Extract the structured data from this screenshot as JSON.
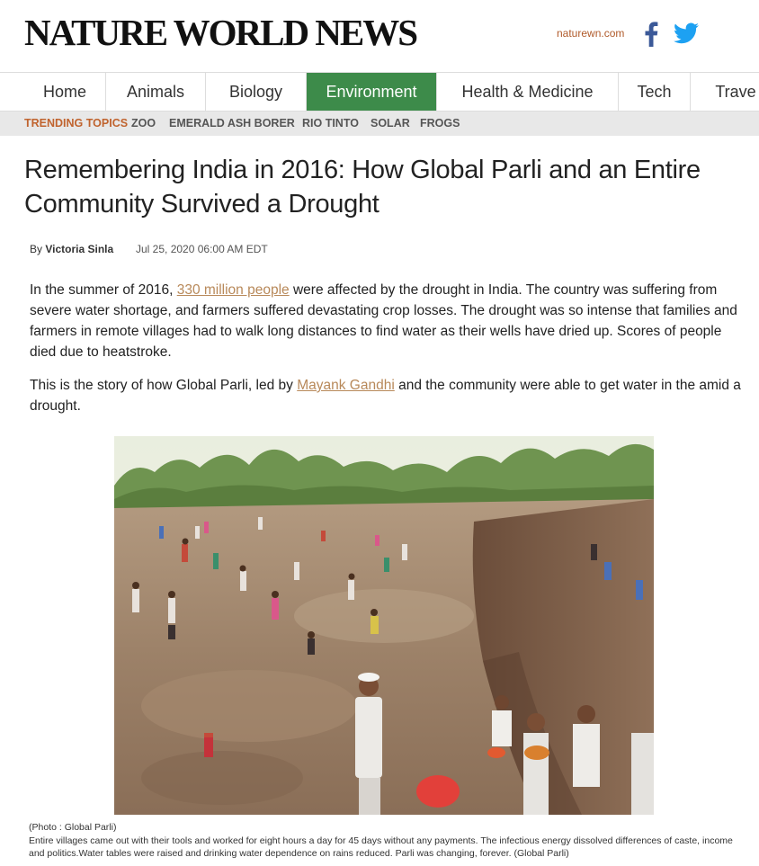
{
  "header": {
    "logo": "NATURE WORLD NEWS",
    "site_link": "naturewn.com"
  },
  "nav": {
    "items": [
      {
        "label": "Home"
      },
      {
        "label": "Animals"
      },
      {
        "label": "Biology"
      },
      {
        "label": "Environment"
      },
      {
        "label": "Health & Medicine"
      },
      {
        "label": "Tech"
      },
      {
        "label": "Trave"
      }
    ],
    "active": "Environment"
  },
  "trending": {
    "label": "TRENDING TOPICS",
    "topics": [
      "ZOO",
      "EMERALD ASH BORER",
      "RIO TINTO",
      "SOLAR",
      "FROGS"
    ]
  },
  "article": {
    "headline": "Remembering India in 2016: How Global Parli and an Entire Community Survived a Drought",
    "byline_prefix": "By ",
    "author": "Victoria Sinla",
    "date": "Jul 25, 2020 06:00 AM EDT",
    "p1_before": "In the summer of 2016, ",
    "p1_link": "330 million people",
    "p1_after": " were affected by the drought in India. The country was suffering from severe water shortage, and farmers suffered devastating crop losses. The drought was so intense that families and farmers in remote villages had to walk long distances to find water as their wells have dried up. Scores of people died due to heatstroke.",
    "p2_before": "This is the story of how Global Parli, led by ",
    "p2_link": "Mayank Gandhi",
    "p2_after": " and the community were able to get water in the amid a drought.",
    "photo_credit": "(Photo : Global Parli)",
    "caption": "Entire villages came out with their tools and worked for eight hours a day for 45 days without any payments. The infectious energy dissolved differences of caste, income and politics.Water tables were raised and drinking water dependence on rains reduced. Parli was changing, forever. (Global Parli)"
  },
  "colors": {
    "nav_active": "#3d8b4a",
    "trending_label": "#c0632e",
    "link": "#b8895a",
    "facebook": "#3b5998",
    "twitter": "#1da1f2"
  },
  "icons": [
    "facebook-icon",
    "twitter-icon"
  ]
}
